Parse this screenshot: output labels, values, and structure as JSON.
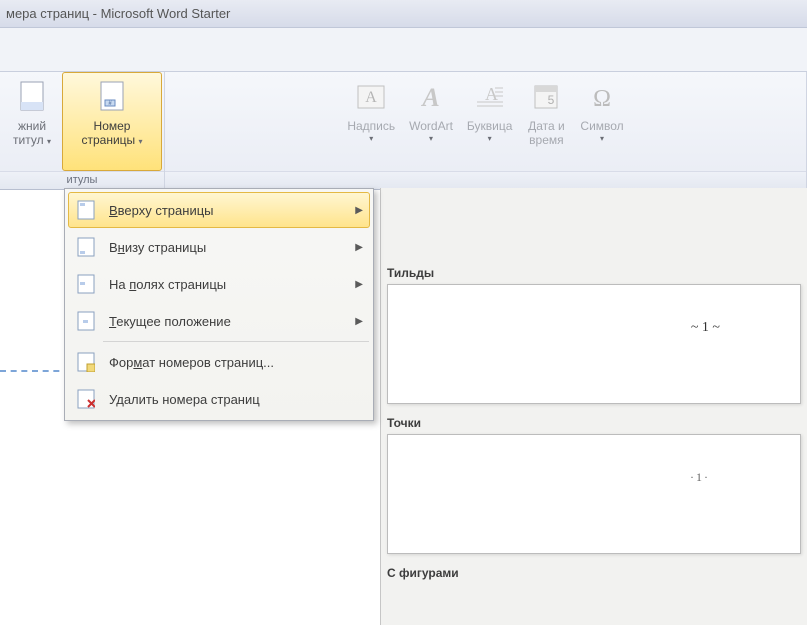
{
  "titlebar": "мера страниц - Microsoft Word Starter",
  "ribbon": {
    "group1": {
      "label": "итулы",
      "btn_footer": {
        "line1": "жний",
        "line2": "титул"
      },
      "btn_pagenum": {
        "line1": "Номер",
        "line2": "страницы"
      }
    },
    "btn_textbox": "Надпись",
    "btn_wordart": "WordArt",
    "btn_dropcap": "Буквица",
    "btn_datetime": {
      "line1": "Дата и",
      "line2": "время"
    },
    "btn_symbol": "Символ"
  },
  "menu": {
    "top": "Вверху страницы",
    "bottom": "Внизу страницы",
    "margins": "На полях страницы",
    "current": "Текущее положение",
    "format": "Формат номеров страниц...",
    "remove": "Удалить номера страниц"
  },
  "gallery": {
    "sec1_title": "Тильды",
    "sec1_sample": "~ 1 ~",
    "sec2_title": "Точки",
    "sec2_sample": "·1·",
    "sec3_title": "С фигурами"
  }
}
